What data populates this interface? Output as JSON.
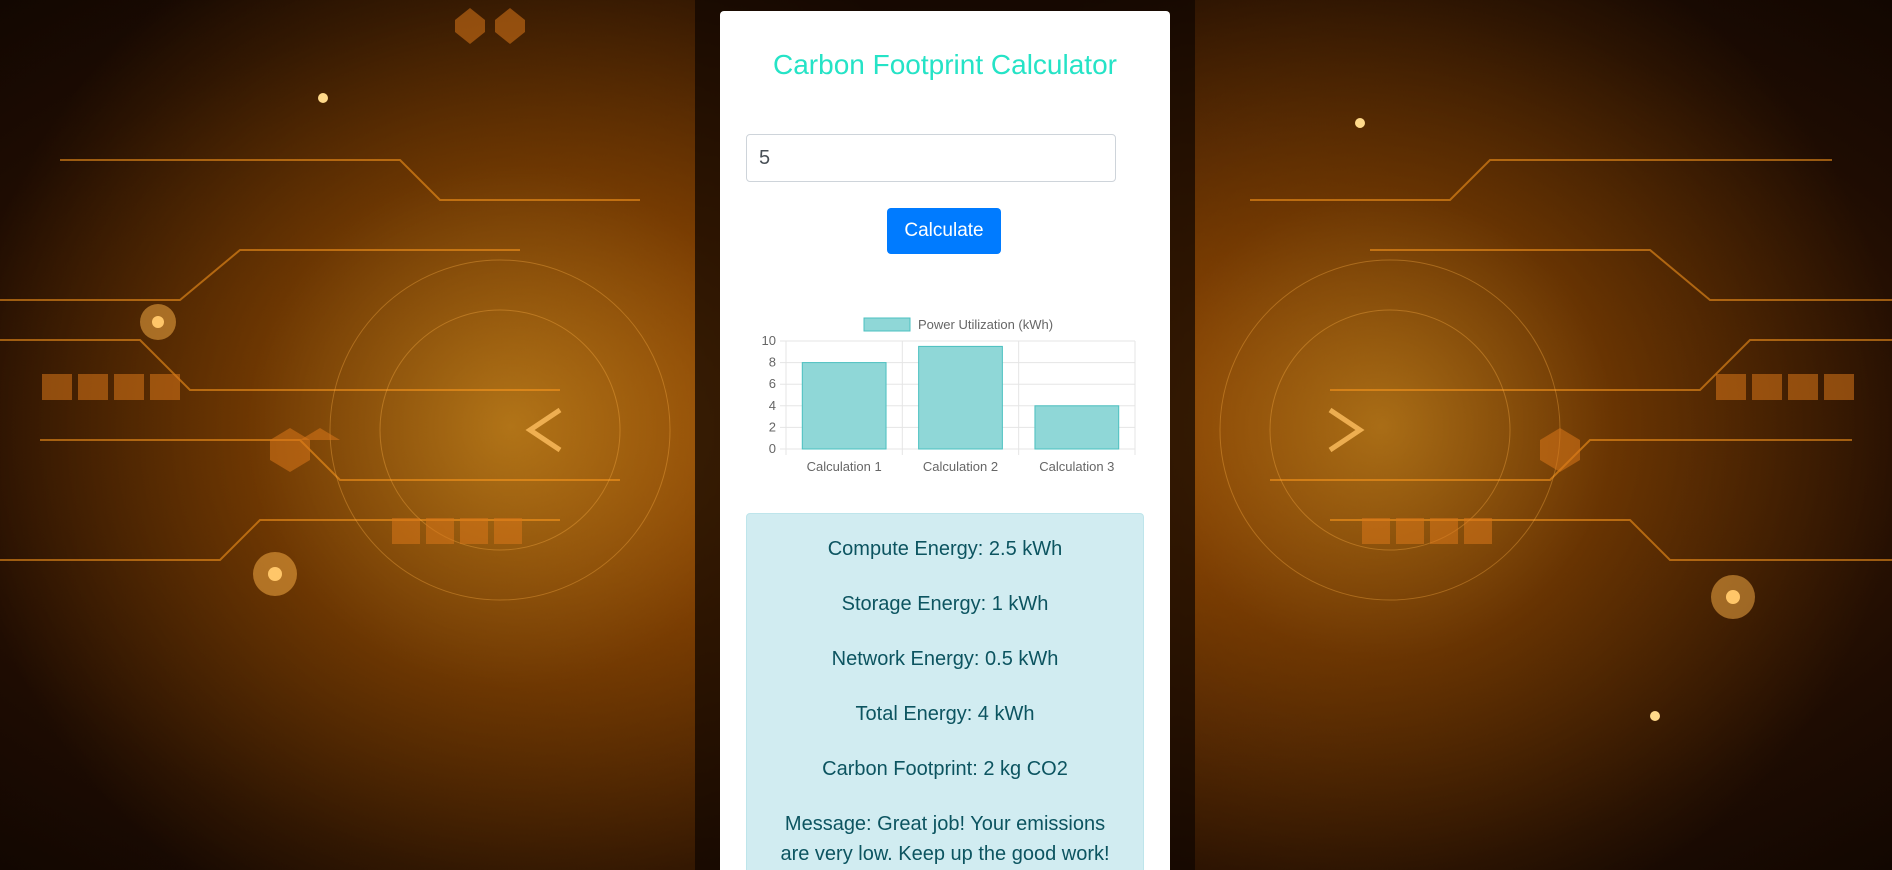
{
  "page": {
    "title": "Carbon Footprint Calculator"
  },
  "form": {
    "input_value": "5",
    "button_label": "Calculate"
  },
  "chart_data": {
    "type": "bar",
    "categories": [
      "Calculation 1",
      "Calculation 2",
      "Calculation 3"
    ],
    "series": [
      {
        "name": "Power Utilization (kWh)",
        "values": [
          8,
          9.5,
          4
        ]
      }
    ],
    "ylim": [
      0,
      10
    ],
    "yticks": [
      "0",
      "2",
      "4",
      "6",
      "8",
      "10"
    ],
    "legend": "top",
    "grid": true,
    "bar_color": "#8fd7d7",
    "bar_border": "#4bc0c0"
  },
  "results": {
    "compute_energy": "Compute Energy: 2.5 kWh",
    "storage_energy": "Storage Energy: 1 kWh",
    "network_energy": "Network Energy: 0.5 kWh",
    "total_energy": "Total Energy: 4 kWh",
    "carbon_footprint": "Carbon Footprint: 2 kg CO2",
    "message": "Message: Great job! Your emissions are very low. Keep up the good work!"
  },
  "colors": {
    "title": "#25e3c6",
    "button": "#007bff",
    "result_bg": "#d1ecf1",
    "result_text": "#0c5460"
  }
}
